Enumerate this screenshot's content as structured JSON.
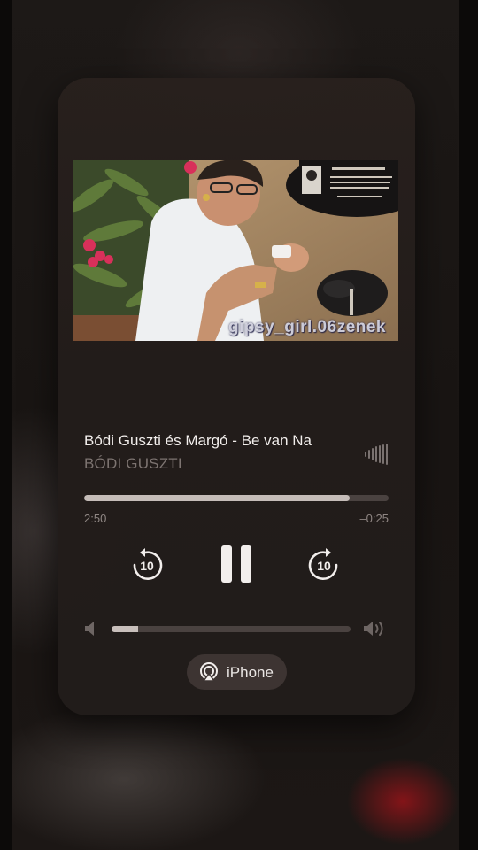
{
  "now_playing": {
    "title": "Bódi Guszti és Margó - Be van Na",
    "artist": "BÓDI GUSZTI",
    "artwork_watermark": "gipsy_girl.06zenek"
  },
  "playback": {
    "elapsed": "2:50",
    "remaining": "–0:25",
    "progress_fraction": 0.873,
    "state": "playing",
    "skip_back_seconds": "10",
    "skip_forward_seconds": "10"
  },
  "volume": {
    "level_fraction": 0.11
  },
  "output_route": {
    "label": "iPhone",
    "icon": "airplay-icon"
  },
  "colors": {
    "panel": "#28201d",
    "track": "#4a4240",
    "fill": "#c5bcb8",
    "accent_bg": "#8f1418"
  }
}
